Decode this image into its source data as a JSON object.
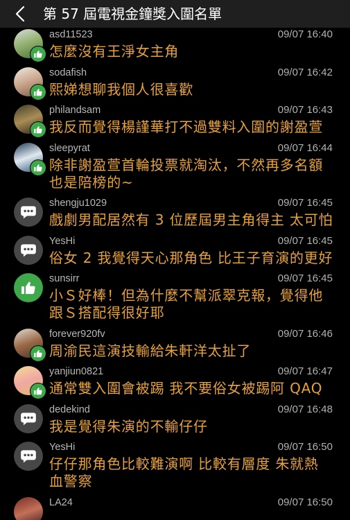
{
  "header": {
    "title": "第 57 屆電視金鐘獎入圍名單",
    "back_icon": "chevron-left-icon"
  },
  "colors": {
    "page_background": "#000000",
    "header_background": "#1f1f1f",
    "title": "#ffffff",
    "username": "#b8b8b8",
    "timestamp": "#b3b3b3",
    "comment_text": "#e6a13c",
    "push_green": "#3fa84b",
    "bubble_avatar": "#474747"
  },
  "comments": [
    {
      "user": "asd11523",
      "time": "09/07 16:40",
      "lines": [
        "怎麼沒有王淨女主角"
      ],
      "avatar": {
        "kind": "photo",
        "colors": [
          "#d9ddd8",
          "#8fae6c",
          "#4a7436"
        ]
      },
      "badge": "thumbs-up-icon"
    },
    {
      "user": "sodafish",
      "time": "09/07 16:42",
      "lines": [
        "熙娣想聊我個人很喜歡"
      ],
      "avatar": {
        "kind": "photo",
        "colors": [
          "#efe9df",
          "#caa58b",
          "#7d5f4d"
        ]
      },
      "badge": "thumbs-up-icon"
    },
    {
      "user": "philandsam",
      "time": "09/07 16:43",
      "lines": [
        "我反而覺得楊謹華打不過雙料入圍的謝盈萱"
      ],
      "avatar": {
        "kind": "photo",
        "colors": [
          "#3e3f2a",
          "#a98d55",
          "#2c261a"
        ]
      },
      "badge": "thumbs-up-icon"
    },
    {
      "user": "sleepyrat",
      "time": "09/07 16:44",
      "lines": [
        "除非謝盈萱首輪投票就淘汰，不然再多名額",
        "也是陪榜的~"
      ],
      "avatar": {
        "kind": "photo",
        "colors": [
          "#233a57",
          "#dfe8ef",
          "#2f5275"
        ]
      },
      "badge": "thumbs-up-icon"
    },
    {
      "user": "shengju1029",
      "time": "09/07 16:45",
      "lines": [
        "戲劇男配居然有 3 位歷屆男主角得主 太可怕"
      ],
      "avatar": {
        "kind": "default",
        "icon": "speech-bubble-icon"
      }
    },
    {
      "user": "YesHi",
      "time": "09/07 16:45",
      "lines": [
        "俗女 2 我覺得天心那角色 比王子育演的更好"
      ],
      "avatar": {
        "kind": "default",
        "icon": "speech-bubble-icon"
      }
    },
    {
      "user": "sunsirr",
      "time": "09/07 16:45",
      "lines": [
        "小Ｓ好棒！但為什麼不幫派翠克報，覺得他",
        "跟Ｓ搭配得很好耶"
      ],
      "avatar": {
        "kind": "default",
        "icon": "thumbs-up-icon"
      }
    },
    {
      "user": "forever920fv",
      "time": "09/07 16:46",
      "lines": [
        "周渝民這演技輸給朱軒洋太扯了"
      ],
      "avatar": {
        "kind": "photo",
        "colors": [
          "#e3dcd2",
          "#9a6a48",
          "#4a3527"
        ]
      },
      "badge": "thumbs-up-icon"
    },
    {
      "user": "yanjiun0821",
      "time": "09/07 16:47",
      "lines": [
        "通常雙入圍會被踢 我不要俗女被踢阿 QAQ"
      ],
      "avatar": {
        "kind": "photo",
        "colors": [
          "#f4dd95",
          "#f0a8a2",
          "#e3b86e"
        ]
      },
      "badge": "thumbs-up-icon"
    },
    {
      "user": "dedekind",
      "time": "09/07 16:48",
      "lines": [
        "我是覺得朱演的不輸仔仔"
      ],
      "avatar": {
        "kind": "default",
        "icon": "speech-bubble-icon"
      }
    },
    {
      "user": "YesHi",
      "time": "09/07 16:50",
      "lines": [
        "仔仔那角色比較難演啊 比較有層度 朱就熱",
        "血警察"
      ],
      "avatar": {
        "kind": "default",
        "icon": "speech-bubble-icon"
      }
    },
    {
      "user": "LA24",
      "time": "09/07 16:50",
      "lines": [],
      "avatar": {
        "kind": "photo",
        "colors": [
          "#7a2e24",
          "#c4705a",
          "#3b1b16"
        ]
      }
    }
  ]
}
